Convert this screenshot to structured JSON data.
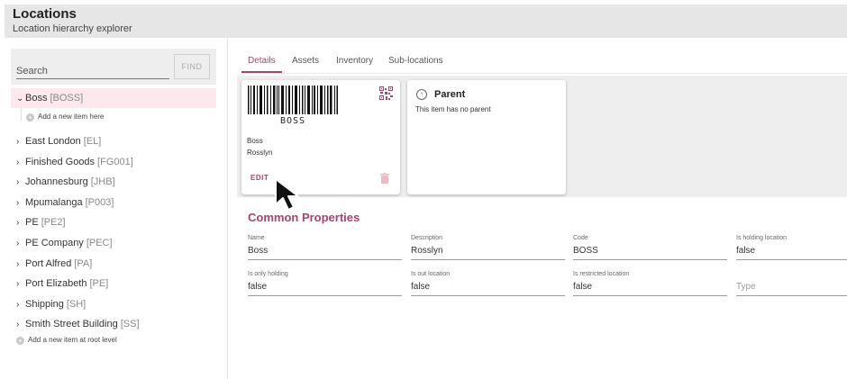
{
  "header": {
    "title": "Locations",
    "subtitle": "Location hierarchy explorer"
  },
  "sidebar": {
    "search": {
      "placeholder": "Search",
      "value": "",
      "find_label": "FIND"
    },
    "selected": {
      "label": "Boss",
      "code": "[BOSS]"
    },
    "add_child_label": "Add a new item here",
    "items": [
      {
        "label": "East London",
        "code": "[EL]"
      },
      {
        "label": "Finished Goods",
        "code": "[FG001]"
      },
      {
        "label": "Johannesburg",
        "code": "[JHB]"
      },
      {
        "label": "Mpumalanga",
        "code": "[P003]"
      },
      {
        "label": "PE",
        "code": "[PE2]"
      },
      {
        "label": "PE Company",
        "code": "[PEC]"
      },
      {
        "label": "Port Alfred",
        "code": "[PA]"
      },
      {
        "label": "Port Elizabeth",
        "code": "[PE]"
      },
      {
        "label": "Shipping",
        "code": "[SH]"
      },
      {
        "label": "Smith Street Building",
        "code": "[SS]"
      }
    ],
    "add_root_label": "Add a new item at root level"
  },
  "tabs": [
    "Details",
    "Assets",
    "Inventory",
    "Sub-locations"
  ],
  "item_card": {
    "barcode_text": "BOSS",
    "name": "Boss",
    "description": "Rosslyn",
    "edit_label": "EDIT"
  },
  "parent_card": {
    "title": "Parent",
    "message": "This item has no parent"
  },
  "properties": {
    "title": "Common Properties",
    "fields": [
      {
        "label": "Name",
        "value": "Boss"
      },
      {
        "label": "Description",
        "value": "Rosslyn"
      },
      {
        "label": "Code",
        "value": "BOSS"
      },
      {
        "label": "Is holding location",
        "value": "false"
      },
      {
        "label": "Is only holding",
        "value": "false"
      },
      {
        "label": "Is out location",
        "value": "false"
      },
      {
        "label": "Is restricted location",
        "value": "false"
      },
      {
        "label": "",
        "value": "",
        "placeholder": "Type"
      }
    ]
  },
  "colors": {
    "accent": "#a8446b",
    "selected_bg": "#fbe9ee",
    "header_bg": "#e6e6e6",
    "panel_bg": "#eeeeee"
  }
}
